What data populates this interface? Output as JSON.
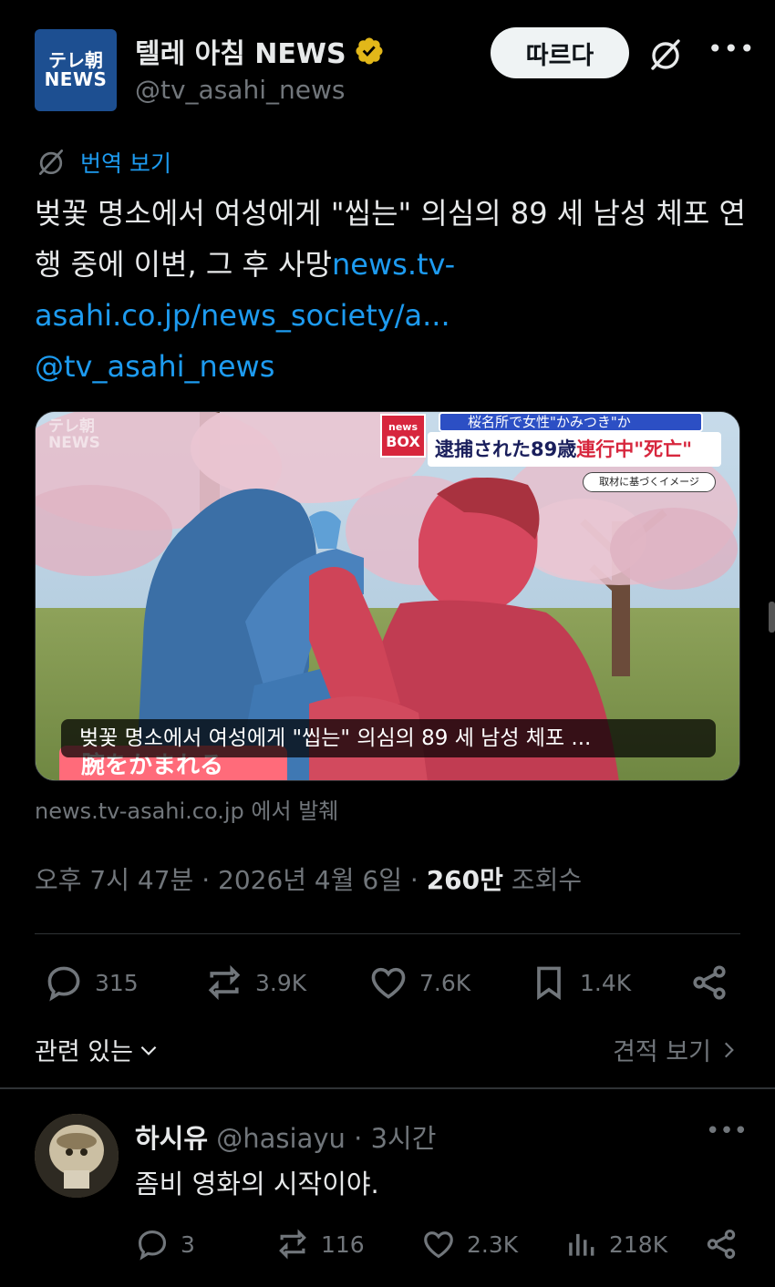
{
  "post": {
    "account": {
      "logo_line1": "テレ朝",
      "logo_line2": "NEWS",
      "display_name": "텔레 아침 NEWS",
      "handle": "@tv_asahi_news",
      "verified": true,
      "follow_label": "따르다"
    },
    "translate_label": "번역 보기",
    "text": "벚꽃 명소에서 여성에게 \"씹는\" 의심의 89 세 남성 체포 연행 중에 이변, 그 후 사망",
    "link_text": "news.tv-asahi.co.jp/news_society/a...",
    "mention": "@tv_asahi_news",
    "media": {
      "caption": "벚꽃 명소에서 여성에게 \"씹는\" 의심의 89 세 남성 체포 ...",
      "ghost_logo_line1": "テレ朝",
      "ghost_logo_line2": "NEWS",
      "newsbox_line1": "news",
      "newsbox_line2": "BOX",
      "headline_top": "桜名所で女性\"かみつき\"か",
      "headline_main_a": "逮捕された89歳",
      "headline_main_b": "連行中\"死亡\"",
      "headline_tag": "取材に基づくイメージ",
      "subtitle": "腕をかまれる"
    },
    "source": "news.tv-asahi.co.jp 에서 발췌",
    "meta": {
      "time": "오후 7시 47분",
      "date": "2026년 4월 6일",
      "views_count": "260만",
      "views_label": "조회수"
    },
    "stats": {
      "replies": "315",
      "reposts": "3.9K",
      "likes": "7.6K",
      "bookmarks": "1.4K"
    },
    "related_label": "관련 있는",
    "quotes_label": "견적 보기"
  },
  "reply": {
    "name": "하시유",
    "handle": "@hasiayu",
    "time": "3시간",
    "text": "좀비 영화의 시작이야.",
    "stats": {
      "replies": "3",
      "reposts": "116",
      "likes": "2.3K",
      "views": "218K"
    }
  },
  "colors": {
    "background": "#000000",
    "text_primary": "#e7e9ea",
    "text_secondary": "#71767b",
    "link": "#1d9bf0",
    "verified_gold": "#e2b719",
    "divider": "#2f3336"
  },
  "icons": [
    "verified-badge-icon",
    "grok-icon",
    "more-icon",
    "translate-icon",
    "reply-icon",
    "repost-icon",
    "like-icon",
    "bookmark-icon",
    "share-icon",
    "chevron-down-icon",
    "chevron-right-icon",
    "views-icon"
  ]
}
